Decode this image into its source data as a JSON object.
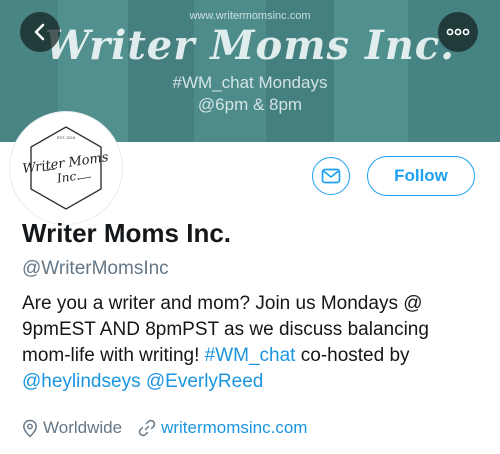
{
  "banner": {
    "url_text": "www.writermomsinc.com",
    "title": "Writer Moms Inc.",
    "hashtag_line": "#WM_chat Mondays",
    "time_line": "@6pm & 8pm"
  },
  "nav": {
    "back_icon": "chevron-left-icon",
    "more_icon": "more-dots-icon"
  },
  "avatar": {
    "top_text": "EST. 2016",
    "logo_line1": "Writer Moms",
    "logo_line2": "Inc."
  },
  "actions": {
    "message_icon": "envelope-icon",
    "follow_label": "Follow",
    "accent_color": "#1da1f2"
  },
  "profile": {
    "display_name": "Writer Moms Inc.",
    "handle": "@WriterMomsInc",
    "bio": {
      "part1": "Are you a writer and mom? Join us Mondays @ 9pmEST AND 8pmPST as we discuss balancing mom-life with writing! ",
      "hashtag": "#WM_chat",
      "part2": " co-hosted by ",
      "mention1": "@heylindseys",
      "space": " ",
      "mention2": "@EverlyReed"
    },
    "location": "Worldwide",
    "website": "writermomsinc.com"
  }
}
